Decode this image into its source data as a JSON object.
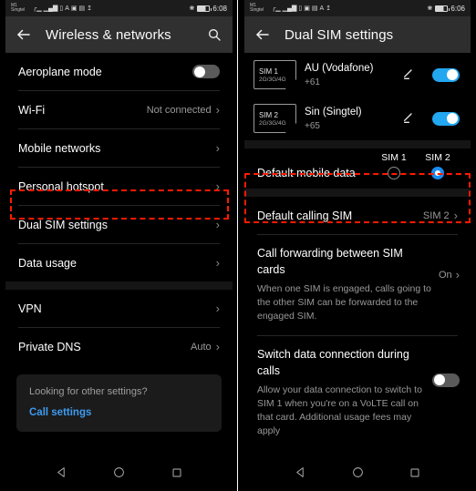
{
  "left_phone": {
    "status": {
      "carrier_line1": "M1",
      "carrier_line2": "Singtel",
      "time": "6:08"
    },
    "appbar": {
      "title": "Wireless & networks",
      "back_icon": "back-arrow-icon",
      "search_icon": "search-icon"
    },
    "items": [
      {
        "label": "Aeroplane mode",
        "type": "switch",
        "checked": false
      },
      {
        "label": "Wi-Fi",
        "type": "nav",
        "value": "Not connected"
      },
      {
        "label": "Mobile networks",
        "type": "nav",
        "value": ""
      },
      {
        "label": "Personal hotspot",
        "type": "nav",
        "value": ""
      },
      {
        "label": "Dual SIM settings",
        "type": "nav",
        "value": "",
        "highlighted": true
      },
      {
        "label": "Data usage",
        "type": "nav",
        "value": ""
      }
    ],
    "items2": [
      {
        "label": "VPN",
        "type": "nav",
        "value": ""
      },
      {
        "label": "Private DNS",
        "type": "nav",
        "value": "Auto"
      }
    ],
    "card": {
      "question": "Looking for other settings?",
      "link": "Call settings"
    },
    "nav": {
      "back": "back-nav-icon",
      "home": "home-nav-icon",
      "recents": "recents-nav-icon"
    }
  },
  "right_phone": {
    "status": {
      "carrier_line1": "M1",
      "carrier_line2": "Singtel",
      "time": "6:06"
    },
    "appbar": {
      "title": "Dual SIM settings",
      "back_icon": "back-arrow-icon"
    },
    "sims": [
      {
        "slot": "SIM 1",
        "tech": "2G/3G/4G",
        "operator": "AU (Vodafone)",
        "number": "+61",
        "enabled": true
      },
      {
        "slot": "SIM 2",
        "tech": "2G/3G/4G",
        "operator": "Sin (Singtel)",
        "number": "+65",
        "enabled": true
      }
    ],
    "default_mobile_data": {
      "label": "Default mobile data",
      "col1": "SIM 1",
      "col2": "SIM 2",
      "selected": "SIM 2"
    },
    "default_calling": {
      "label": "Default calling SIM",
      "value": "SIM 2"
    },
    "call_forwarding": {
      "title": "Call forwarding between SIM cards",
      "description": "When one SIM is engaged, calls going to the other SIM can be forwarded to the engaged SIM.",
      "value": "On"
    },
    "switch_data": {
      "title": "Switch data connection during calls",
      "description": "Allow your data connection to switch to SIM 1 when you're on a VoLTE call on that card. Additional usage fees may apply",
      "checked": false
    },
    "nav": {
      "back": "back-nav-icon",
      "home": "home-nav-icon",
      "recents": "recents-nav-icon"
    }
  },
  "colors": {
    "accent": "#22a7f0",
    "link": "#3d9bf0",
    "highlight": "#ff1a00",
    "background": "#000000"
  }
}
